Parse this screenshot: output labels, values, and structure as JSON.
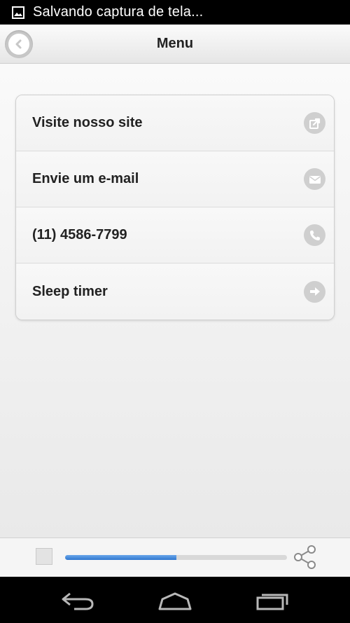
{
  "status_bar": {
    "notification_text": "Salvando captura de tela..."
  },
  "header": {
    "title": "Menu"
  },
  "menu": {
    "items": [
      {
        "label": "Visite nosso site",
        "icon": "external-link-icon"
      },
      {
        "label": "Envie um e-mail",
        "icon": "mail-icon"
      },
      {
        "label": "(11) 4586-7799",
        "icon": "phone-icon"
      },
      {
        "label": "Sleep timer",
        "icon": "arrow-right-icon"
      }
    ]
  },
  "player": {
    "progress_percent": 50
  },
  "colors": {
    "accent": "#3a80d6",
    "icon_bg": "#cfcfcf"
  }
}
